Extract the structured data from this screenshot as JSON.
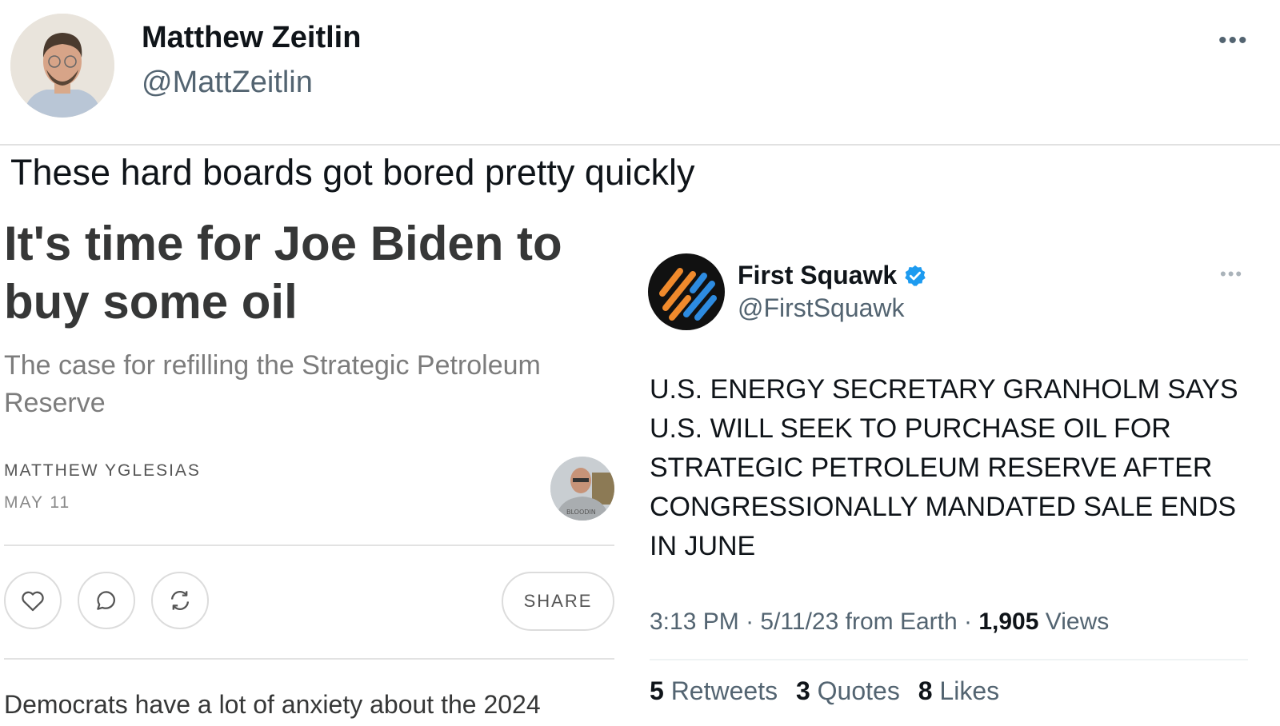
{
  "tweet": {
    "display_name": "Matthew Zeitlin",
    "handle": "@MattZeitlin",
    "more": "•••",
    "text": "These hard boards got bored pretty quickly"
  },
  "article": {
    "title": "It's time for Joe Biden to buy some oil",
    "subtitle": "The case for refilling the Strategic Petroleum Reserve",
    "author": "MATTHEW YGLESIAS",
    "date": "MAY 11",
    "share_label": "SHARE",
    "avatar_text": "BLOODIN",
    "body_preview": "Democrats have a lot of anxiety about the 2024"
  },
  "quoted_tweet": {
    "display_name": "First Squawk",
    "handle": "@FirstSquawk",
    "more": "•••",
    "verified_color": "#1d9bf0",
    "text": "U.S. ENERGY SECRETARY GRANHOLM SAYS U.S. WILL SEEK TO PURCHASE OIL FOR STRATEGIC PETROLEUM RESERVE AFTER CONGRESSIONALLY MANDATED SALE ENDS IN JUNE",
    "time": "3:13 PM",
    "date": "5/11/23",
    "source": "from Earth",
    "views_count": "1,905",
    "views_label": "Views",
    "retweets_count": "5",
    "retweets_label": "Retweets",
    "quotes_count": "3",
    "quotes_label": "Quotes",
    "likes_count": "8",
    "likes_label": "Likes"
  },
  "icons": [
    "heart-icon",
    "comment-icon",
    "restack-icon",
    "verified-badge-icon",
    "more-icon"
  ]
}
